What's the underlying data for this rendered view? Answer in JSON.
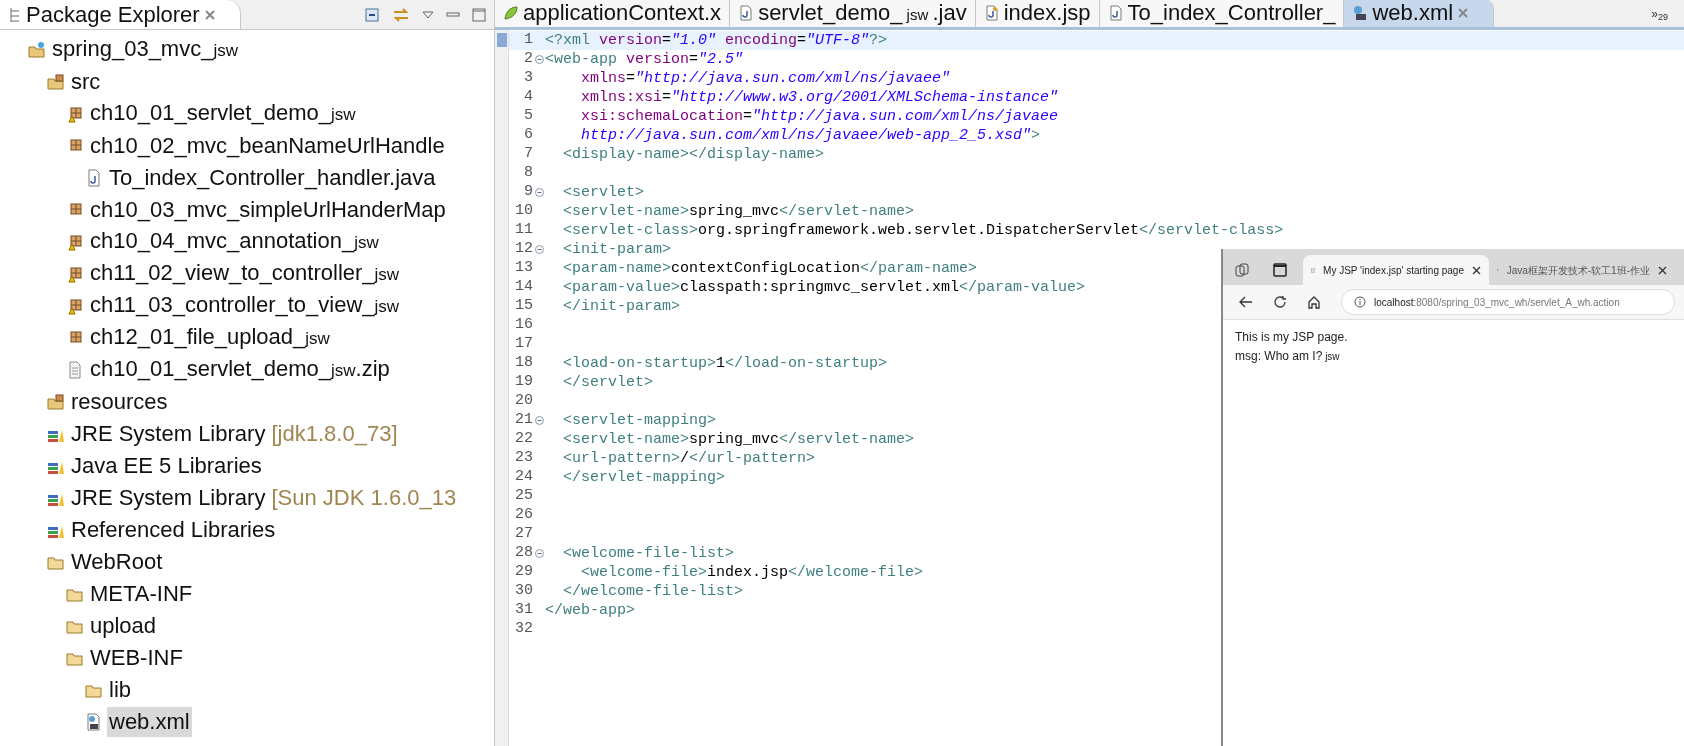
{
  "explorer": {
    "title": "Package Explorer",
    "tree": [
      {
        "kind": "project",
        "label": "spring_03_mvc_",
        "suffix": "jsw",
        "selected": false,
        "children": [
          {
            "kind": "source-folder",
            "label": "src",
            "selected": false,
            "children": [
              {
                "kind": "package-warning",
                "label": "ch10_01_servlet_demo_",
                "suffix": "jsw",
                "selected": false
              },
              {
                "kind": "package",
                "label": "ch10_02_mvc_beanNameUrlHandle",
                "selected": false,
                "children": [
                  {
                    "kind": "java-file",
                    "label": "To_index_Controller_handler.java",
                    "selected": false
                  }
                ]
              },
              {
                "kind": "package",
                "label": "ch10_03_mvc_simpleUrlHanderMap",
                "selected": false
              },
              {
                "kind": "package-warning",
                "label": "ch10_04_mvc_annotation_",
                "suffix": "jsw",
                "selected": false
              },
              {
                "kind": "package-warning",
                "label": "ch11_02_view_to_controller_",
                "suffix": "jsw",
                "selected": false
              },
              {
                "kind": "package-warning",
                "label": "ch11_03_controller_to_view_",
                "suffix": "jsw",
                "selected": false
              },
              {
                "kind": "package",
                "label": "ch12_01_file_upload_",
                "suffix": "jsw",
                "selected": false
              },
              {
                "kind": "zip-file",
                "label": "ch10_01_servlet_demo_",
                "suffix": "jsw",
                "after": ".zip",
                "selected": false
              }
            ]
          },
          {
            "kind": "source-folder",
            "label": "resources",
            "selected": false
          },
          {
            "kind": "library",
            "label": "JRE System Library",
            "decoration": "[jdk1.8.0_73]",
            "selected": false
          },
          {
            "kind": "library",
            "label": "Java EE 5 Libraries",
            "selected": false
          },
          {
            "kind": "library",
            "label": "JRE System Library",
            "decoration": "[Sun JDK 1.6.0_13",
            "selected": false
          },
          {
            "kind": "library",
            "label": "Referenced Libraries",
            "selected": false
          },
          {
            "kind": "web-folder",
            "label": "WebRoot",
            "selected": false,
            "children": [
              {
                "kind": "folder",
                "label": "META-INF",
                "selected": false
              },
              {
                "kind": "folder",
                "label": "upload",
                "selected": false
              },
              {
                "kind": "folder",
                "label": "WEB-INF",
                "selected": false,
                "children": [
                  {
                    "kind": "folder",
                    "label": "lib",
                    "selected": false
                  },
                  {
                    "kind": "xml-file",
                    "label": "web.xml",
                    "selected": true
                  }
                ]
              }
            ]
          }
        ]
      }
    ]
  },
  "editor": {
    "tabs": [
      {
        "kind": "xml",
        "label": "applicationContext.x",
        "selected": false
      },
      {
        "kind": "java",
        "label": "servlet_demo_",
        "suffix": "jsw",
        "after": ".jav",
        "selected": false
      },
      {
        "kind": "jsp",
        "label": "index.jsp",
        "selected": false
      },
      {
        "kind": "java",
        "label": "To_index_Controller_",
        "selected": false
      },
      {
        "kind": "webxml",
        "label": "web.xml",
        "selected": true
      }
    ],
    "overflow": "»",
    "overflow_count": "29",
    "lines": [
      {
        "n": "1",
        "current": true,
        "fold": false,
        "tokens": [
          {
            "kind": "t",
            "s": "<?xml"
          },
          {
            "kind": "a",
            "s": " version"
          },
          {
            "kind": "x",
            "s": "="
          },
          {
            "kind": "s",
            "s": "\"1.0\""
          },
          {
            "kind": "a",
            "s": " encoding"
          },
          {
            "kind": "x",
            "s": "="
          },
          {
            "kind": "s",
            "s": "\"UTF-8\""
          },
          {
            "kind": "t",
            "s": "?>"
          }
        ]
      },
      {
        "n": "2",
        "current": false,
        "fold": true,
        "tokens": [
          {
            "kind": "t",
            "s": "<web-app"
          },
          {
            "kind": "a",
            "s": " version"
          },
          {
            "kind": "x",
            "s": "="
          },
          {
            "kind": "s",
            "s": "\"2.5\""
          }
        ]
      },
      {
        "n": "3",
        "current": false,
        "fold": false,
        "tokens": [
          {
            "kind": "a",
            "s": "    xmlns"
          },
          {
            "kind": "x",
            "s": "="
          },
          {
            "kind": "s",
            "s": "\"http://java.sun.com/xml/ns/javaee\""
          }
        ]
      },
      {
        "n": "4",
        "current": false,
        "fold": false,
        "tokens": [
          {
            "kind": "a",
            "s": "    xmlns:xsi"
          },
          {
            "kind": "x",
            "s": "="
          },
          {
            "kind": "s",
            "s": "\"http://www.w3.org/2001/XMLSchema-instance\""
          }
        ]
      },
      {
        "n": "5",
        "current": false,
        "fold": false,
        "tokens": [
          {
            "kind": "a",
            "s": "    xsi:schemaLocation"
          },
          {
            "kind": "x",
            "s": "="
          },
          {
            "kind": "s",
            "s": "\"http://java.sun.com/xml/ns/javaee"
          }
        ]
      },
      {
        "n": "6",
        "current": false,
        "fold": false,
        "tokens": [
          {
            "kind": "s",
            "s": "    http://java.sun.com/xml/ns/javaee/web-app_2_5.xsd\""
          },
          {
            "kind": "t",
            "s": ">"
          }
        ]
      },
      {
        "n": "7",
        "current": false,
        "fold": false,
        "tokens": [
          {
            "kind": "t",
            "s": "  <display-name></display-name>"
          }
        ]
      },
      {
        "n": "8",
        "current": false,
        "fold": false
      },
      {
        "n": "9",
        "current": false,
        "fold": true,
        "tokens": [
          {
            "kind": "t",
            "s": "  <servlet>"
          }
        ]
      },
      {
        "n": "10",
        "current": false,
        "fold": false,
        "tokens": [
          {
            "kind": "t",
            "s": "  <servlet-name>"
          },
          {
            "kind": "x",
            "s": "spring_mvc"
          },
          {
            "kind": "t",
            "s": "</servlet-name>"
          }
        ]
      },
      {
        "n": "11",
        "current": false,
        "fold": false,
        "tokens": [
          {
            "kind": "t",
            "s": "  <servlet-class>"
          },
          {
            "kind": "x",
            "s": "org.springframework.web.servlet.DispatcherServlet"
          },
          {
            "kind": "t",
            "s": "</servlet-class>"
          }
        ]
      },
      {
        "n": "12",
        "current": false,
        "fold": true,
        "tokens": [
          {
            "kind": "t",
            "s": "  <init-param>"
          }
        ]
      },
      {
        "n": "13",
        "current": false,
        "fold": false,
        "tokens": [
          {
            "kind": "t",
            "s": "  <param-name>"
          },
          {
            "kind": "x",
            "s": "contextConfigLocation"
          },
          {
            "kind": "t",
            "s": "</param-name>"
          }
        ]
      },
      {
        "n": "14",
        "current": false,
        "fold": false,
        "tokens": [
          {
            "kind": "t",
            "s": "  <param-value>"
          },
          {
            "kind": "x",
            "s": "classpath:springmvc_servlet.xml"
          },
          {
            "kind": "t",
            "s": "</param-value>"
          }
        ]
      },
      {
        "n": "15",
        "current": false,
        "fold": false,
        "tokens": [
          {
            "kind": "t",
            "s": "  </init-param>"
          }
        ]
      },
      {
        "n": "16",
        "current": false,
        "fold": false
      },
      {
        "n": "17",
        "current": false,
        "fold": false
      },
      {
        "n": "18",
        "current": false,
        "fold": false,
        "tokens": [
          {
            "kind": "t",
            "s": "  <load-on-startup>"
          },
          {
            "kind": "x",
            "s": "1"
          },
          {
            "kind": "t",
            "s": "</load-on-startup>"
          }
        ]
      },
      {
        "n": "19",
        "current": false,
        "fold": false,
        "tokens": [
          {
            "kind": "t",
            "s": "  </servlet>"
          }
        ]
      },
      {
        "n": "20",
        "current": false,
        "fold": false
      },
      {
        "n": "21",
        "current": false,
        "fold": true,
        "tokens": [
          {
            "kind": "t",
            "s": "  <servlet-mapping>"
          }
        ]
      },
      {
        "n": "22",
        "current": false,
        "fold": false,
        "tokens": [
          {
            "kind": "t",
            "s": "  <servlet-name>"
          },
          {
            "kind": "x",
            "s": "spring_mvc"
          },
          {
            "kind": "t",
            "s": "</servlet-name>"
          }
        ]
      },
      {
        "n": "23",
        "current": false,
        "fold": false,
        "tokens": [
          {
            "kind": "t",
            "s": "  <url-pattern>"
          },
          {
            "kind": "x",
            "s": "/"
          },
          {
            "kind": "t",
            "s": "</url-pattern>"
          }
        ]
      },
      {
        "n": "24",
        "current": false,
        "fold": false,
        "tokens": [
          {
            "kind": "t",
            "s": "  </servlet-mapping>"
          }
        ]
      },
      {
        "n": "25",
        "current": false,
        "fold": false
      },
      {
        "n": "26",
        "current": false,
        "fold": false
      },
      {
        "n": "27",
        "current": false,
        "fold": false
      },
      {
        "n": "28",
        "current": false,
        "fold": true,
        "tokens": [
          {
            "kind": "t",
            "s": "  <welcome-file-list>"
          }
        ]
      },
      {
        "n": "29",
        "current": false,
        "fold": false,
        "tokens": [
          {
            "kind": "t",
            "s": "    <welcome-file>"
          },
          {
            "kind": "x",
            "s": "index.jsp"
          },
          {
            "kind": "t",
            "s": "</welcome-file>"
          }
        ]
      },
      {
        "n": "30",
        "current": false,
        "fold": false,
        "tokens": [
          {
            "kind": "t",
            "s": "  </welcome-file-list>"
          }
        ]
      },
      {
        "n": "31",
        "current": false,
        "fold": false,
        "tokens": [
          {
            "kind": "t",
            "s": "</web-app>"
          }
        ]
      },
      {
        "n": "32",
        "current": false,
        "fold": false
      }
    ]
  },
  "browser": {
    "tabs": [
      {
        "label": "My JSP 'index.jsp' starting page",
        "selected": true
      },
      {
        "label": "Java框架开发技术-软工1班-作业",
        "selected": false
      }
    ],
    "url": {
      "host": "localhost",
      "rest": ":8080/spring_03_mvc_wh/servlet_A_wh.action"
    },
    "content": [
      {
        "text": "This is my JSP page."
      },
      {
        "text": "msg: Who am I?",
        "suffix": "jsw"
      }
    ]
  }
}
